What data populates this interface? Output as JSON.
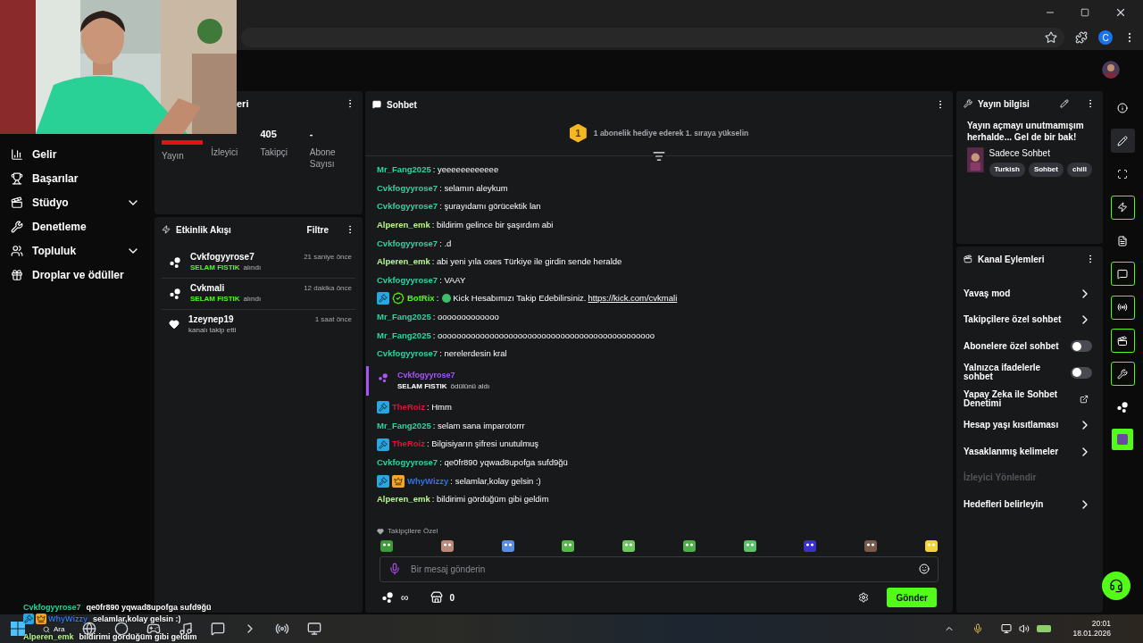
{
  "browser": {
    "profile_letter": "C"
  },
  "sidebar": {
    "items": [
      {
        "label": "Gelir",
        "kind": "link"
      },
      {
        "label": "Başarılar",
        "kind": "link"
      },
      {
        "label": "Stüdyo",
        "kind": "group"
      },
      {
        "label": "Denetleme",
        "kind": "link"
      },
      {
        "label": "Topluluk",
        "kind": "group"
      },
      {
        "label": "Droplar ve ödüller",
        "kind": "link"
      }
    ]
  },
  "stats_card": {
    "title": "eri",
    "stats": [
      {
        "label": "Yayın",
        "kind": "live_bar"
      },
      {
        "label": "İzleyici",
        "kind": "hidden"
      },
      {
        "label": "Takipçi",
        "kind": "text",
        "value": "405"
      },
      {
        "label": "Abone Sayısı",
        "kind": "text",
        "value": "-"
      }
    ]
  },
  "activity": {
    "title": "Etkinlik Akışı",
    "filter": "Filtre",
    "items": [
      {
        "kind": "reward",
        "user": "Cvkfogyyrose7",
        "reward": "SELAM FISTIK",
        "text": "alındı",
        "time": "21 saniye önce"
      },
      {
        "kind": "reward",
        "user": "Cvkmali",
        "reward": "SELAM FISTIK",
        "text": "alındı",
        "time": "12 dakika önce"
      },
      {
        "kind": "follow",
        "user": "1zeynep19",
        "text": "kanalı takip etti",
        "time": "1 saat önce"
      }
    ]
  },
  "chat": {
    "title": "Sohbet",
    "promo": {
      "rank": "1",
      "text": "1 abonelik hediye ederek 1. sıraya yükselin"
    },
    "messages": [
      {
        "kind": "text",
        "user": "Mr_Fang2025",
        "color": "#2fd3a0",
        "text": ": yeeeeeeeeeeee"
      },
      {
        "kind": "text",
        "user": "Cvkfogyyrose7",
        "color": "#2fd3a0",
        "text": ": selamın aleykum"
      },
      {
        "kind": "text",
        "user": "Cvkfogyyrose7",
        "color": "#2fd3a0",
        "text": ": şurayıdamı görücektik lan"
      },
      {
        "kind": "text",
        "user": "Alperen_emk",
        "color": "#b9f78d",
        "text": ": bildirim gelince bir şaşırdım abi"
      },
      {
        "kind": "text",
        "user": "Cvkfogyyrose7",
        "color": "#2fd3a0",
        "text": ": .d"
      },
      {
        "kind": "text",
        "user": "Alperen_emk",
        "color": "#b9f78d",
        "text": ": abi yeni yıla oses Türkiye ile girdin sende heralde"
      },
      {
        "kind": "text",
        "user": "Cvkfogyyrose7",
        "color": "#2fd3a0",
        "text": ": VAAY"
      },
      {
        "kind": "bot",
        "user": "BotRix",
        "color": "#53fc18",
        "badges": [
          {
            "kind": "mod"
          },
          {
            "kind": "verified"
          }
        ],
        "text": ":",
        "body": "Kick Hesabımızı Takip Edebilirsiniz.",
        "link": "https://kick.com/cvkmali"
      },
      {
        "kind": "text",
        "user": "Mr_Fang2025",
        "color": "#2fd3a0",
        "text": ": ooooooooooooo"
      },
      {
        "kind": "text",
        "user": "Mr_Fang2025",
        "color": "#2fd3a0",
        "text": ": oooooooooooooooooooooooooooooooooooooooooooooo"
      },
      {
        "kind": "text",
        "user": "Cvkfogyyrose7",
        "color": "#2fd3a0",
        "text": ": nerelerdesin kral"
      },
      {
        "kind": "reward",
        "user": "Cvkfogyyrose7",
        "color": "#a855f7",
        "reward": "SELAM FISTIK",
        "text": "ödülünü aldı"
      },
      {
        "kind": "text",
        "user": "TheRoiz",
        "color": "#dc143c",
        "badges": [
          {
            "kind": "mod"
          }
        ],
        "text": ": Hmm"
      },
      {
        "kind": "text",
        "user": "Mr_Fang2025",
        "color": "#2fd3a0",
        "text": ": selam sana imparotorrr"
      },
      {
        "kind": "text",
        "user": "TheRoiz",
        "color": "#dc143c",
        "badges": [
          {
            "kind": "mod"
          }
        ],
        "text": ": Bilgisiyarın şifresi unutulmuş"
      },
      {
        "kind": "text",
        "user": "Cvkfogyyrose7",
        "color": "#2fd3a0",
        "text": ": qe0fr890 yqwad8upofga sufd9ğü"
      },
      {
        "kind": "text",
        "user": "WhyWizzy",
        "color": "#2f74e0",
        "badges": [
          {
            "kind": "mod"
          },
          {
            "kind": "crown"
          }
        ],
        "text": ": selamlar,kolay gelsin :)"
      },
      {
        "kind": "text",
        "user": "Alperen_emk",
        "color": "#b9f78d",
        "text": ": bildirimi gördüğüm gibi geldim"
      }
    ],
    "emote_section": "Takipçilere Özel",
    "emotes": [
      {
        "color": "#3f9a3a"
      },
      {
        "color": "#b98a7a"
      },
      {
        "color": "#5a8fe0"
      },
      {
        "color": "#56b84a"
      },
      {
        "color": "#6cc85e"
      },
      {
        "color": "#4fae4a"
      },
      {
        "color": "#5cc06a"
      },
      {
        "color": "#3a2fd0"
      },
      {
        "color": "#7a5a4a"
      },
      {
        "color": "#f2d43a"
      }
    ],
    "input": {
      "placeholder": "Bir mesaj gönderin"
    },
    "points": "∞",
    "store_count": "0",
    "send": "Gönder"
  },
  "stream_info": {
    "title": "Yayın bilgisi",
    "description": "Yayın açmayı unutmamışım herhalde... Gel de bir bak!",
    "category": "Sadece Sohbet",
    "tags": [
      "Turkish",
      "Sohbet",
      "chill"
    ]
  },
  "channel_actions": {
    "title": "Kanal Eylemleri",
    "items": [
      {
        "label": "Yavaş mod",
        "kind": "link"
      },
      {
        "label": "Takipçilere özel sohbet",
        "kind": "link"
      },
      {
        "label": "Abonelere özel sohbet",
        "kind": "toggle",
        "on": false
      },
      {
        "label": "Yalnızca ifadelerle sohbet",
        "kind": "toggle",
        "on": false
      },
      {
        "label": "Yapay Zeka ile Sohbet Denetimi",
        "kind": "external"
      },
      {
        "label": "Hesap yaşı kısıtlaması",
        "kind": "link"
      },
      {
        "label": "Yasaklanmış kelimeler",
        "kind": "link"
      },
      {
        "label": "İzleyici Yönlendir",
        "kind": "muted"
      },
      {
        "label": "Hedefleri belirleyin",
        "kind": "link"
      }
    ]
  },
  "rail": [
    {
      "active": false,
      "selected": false
    },
    {
      "active": false,
      "selected": true
    },
    {
      "active": false,
      "selected": false
    },
    {
      "active": true,
      "selected": false
    },
    {
      "active": false,
      "selected": false
    },
    {
      "active": true,
      "selected": false
    },
    {
      "active": true,
      "selected": false
    },
    {
      "active": true,
      "selected": false
    },
    {
      "active": true,
      "selected": false
    },
    {
      "active": false,
      "selected": false
    },
    {
      "active": false,
      "selected": false
    }
  ],
  "overlay_chat": [
    {
      "user": "Cvkfogyyrose7",
      "color": "#2fd3a0",
      "text": "qe0fr890 yqwad8upofga sufd9ğü"
    },
    {
      "user": "WhyWizzy",
      "color": "#2f74e0",
      "badges": [
        {
          "kind": "mod"
        },
        {
          "kind": "crown"
        }
      ],
      "text": "selamlar,kolay gelsin :)"
    },
    {
      "user": "Alperen_emk",
      "color": "#b9f78d",
      "text": "bildirimi gördüğüm gibi geldim"
    }
  ],
  "taskbar": {
    "search": "Ara",
    "time": "20:01",
    "date": "18.01.2026"
  }
}
